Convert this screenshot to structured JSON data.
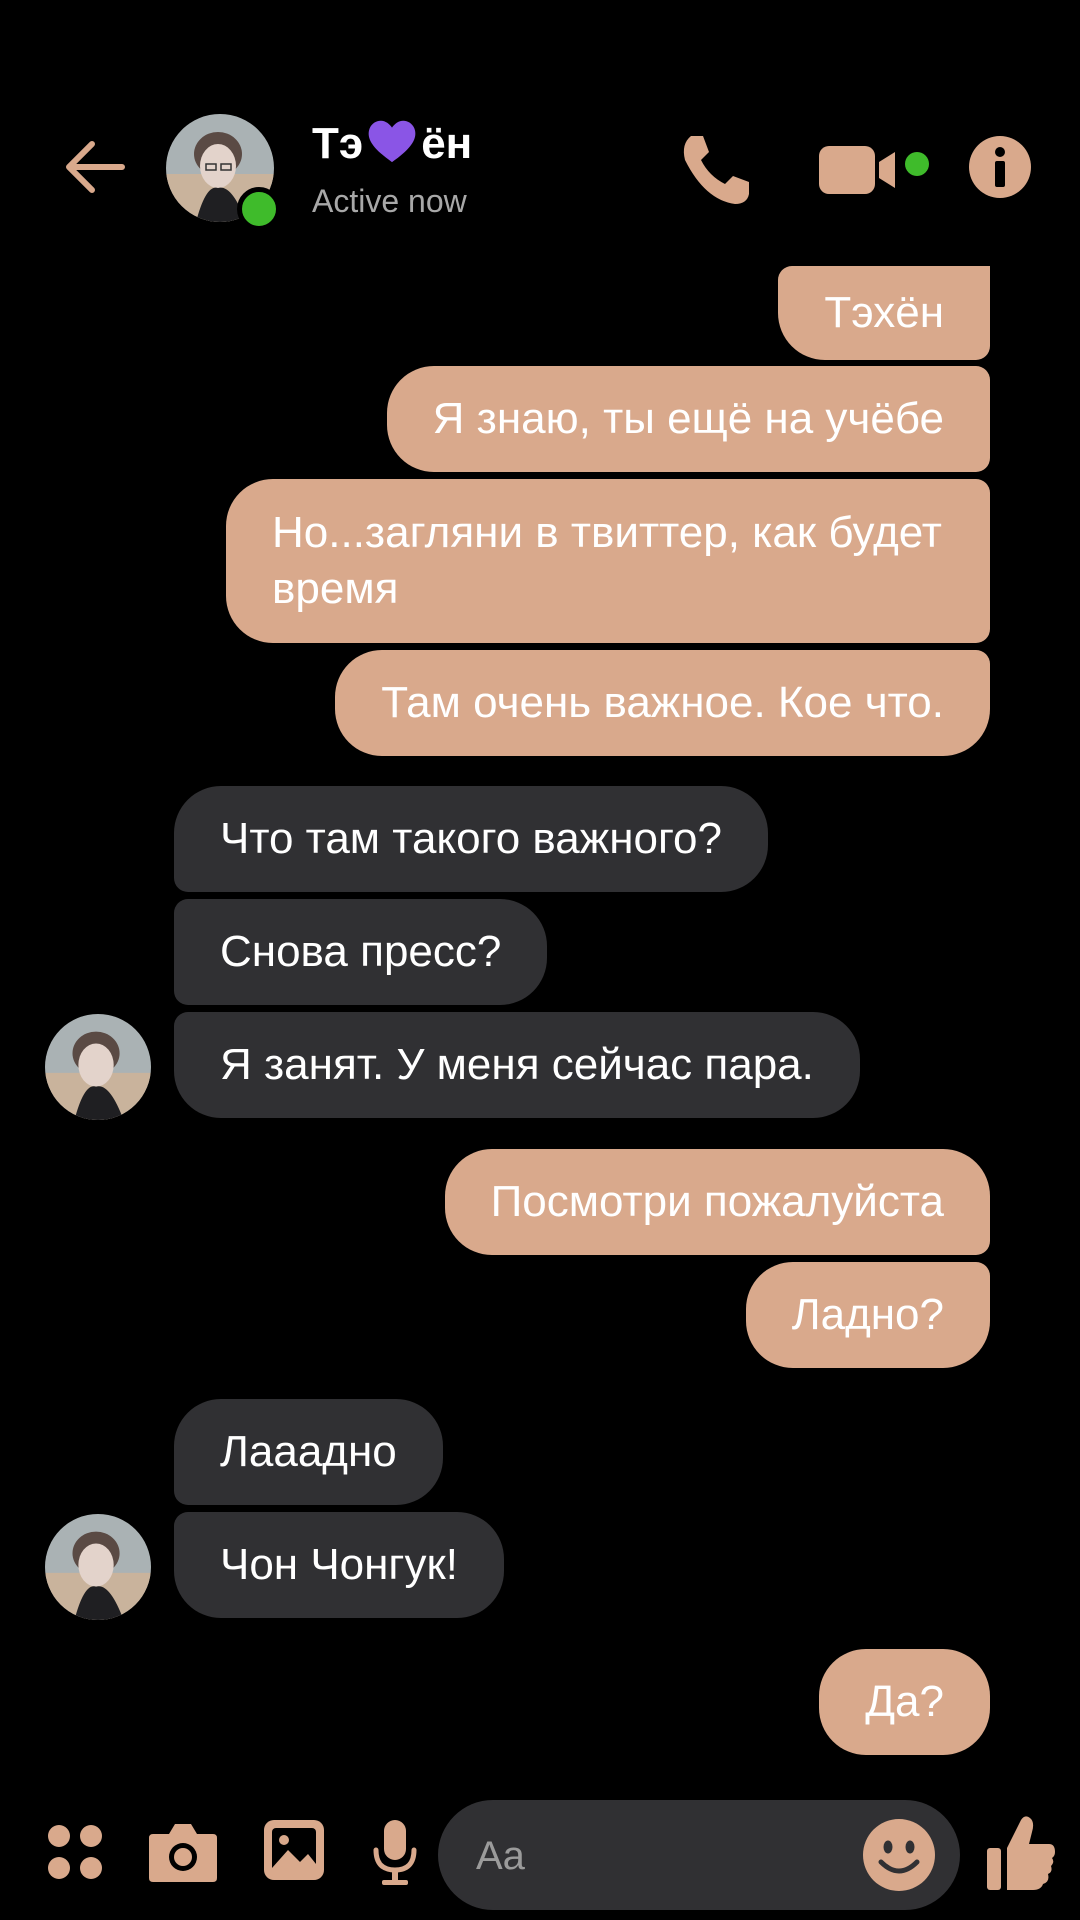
{
  "header": {
    "name_part1": "Тэ",
    "name_part2": "ён",
    "status": "Active now",
    "heart_color": "#8a55e6",
    "online_color": "#3fbb2b",
    "accent_color": "#d9a98c",
    "icons": [
      "back-arrow-icon",
      "phone-icon",
      "video-camera-icon",
      "info-icon"
    ]
  },
  "messages": [
    {
      "from": "me",
      "text": "Тэхён"
    },
    {
      "from": "me",
      "text": "Я знаю, ты ещё на учёбе"
    },
    {
      "from": "me",
      "text": "Но...загляни в твиттер, как будет время"
    },
    {
      "from": "me",
      "text": "Там очень важное. Кое что."
    },
    {
      "from": "them",
      "text": "Что там такого важного?"
    },
    {
      "from": "them",
      "text": "Снова пресс?"
    },
    {
      "from": "them",
      "text": "Я занят. У меня сейчас пара."
    },
    {
      "from": "me",
      "text": "Посмотри пожалуйста"
    },
    {
      "from": "me",
      "text": "Ладно?"
    },
    {
      "from": "them",
      "text": "Лааадно"
    },
    {
      "from": "them",
      "text": "Чон Чонгук!"
    },
    {
      "from": "me",
      "text": "Да?"
    }
  ],
  "composer": {
    "placeholder": "Aa",
    "icons": [
      "apps-icon",
      "camera-icon",
      "gallery-icon",
      "microphone-icon",
      "emoji-icon",
      "thumbs-up-icon"
    ]
  }
}
